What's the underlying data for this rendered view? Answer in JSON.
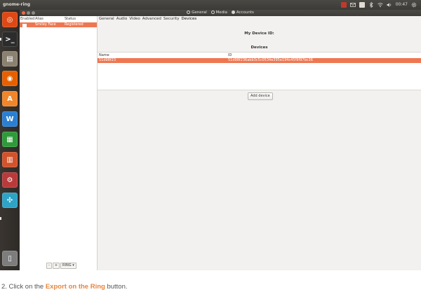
{
  "topbar": {
    "app_title": "gnome-ring",
    "clock": "00:47"
  },
  "launcher": {
    "items": [
      {
        "name": "ubuntu-dash-icon",
        "color": "#dd4814"
      },
      {
        "name": "terminal-icon",
        "color": "#2c2c2c"
      },
      {
        "name": "files-icon",
        "color": "#8b8170"
      },
      {
        "name": "firefox-icon",
        "color": "#e66000"
      },
      {
        "name": "software-center-icon",
        "color": "#f0852a"
      },
      {
        "name": "writer-icon",
        "color": "#2a7fd2"
      },
      {
        "name": "calc-icon",
        "color": "#2f9a3a"
      },
      {
        "name": "impress-icon",
        "color": "#d2532b"
      },
      {
        "name": "system-settings-icon",
        "color": "#b83a3a"
      },
      {
        "name": "ring-icon",
        "color": "#2ea3c6"
      },
      {
        "name": "trash-icon",
        "color": "#7d7d7d"
      }
    ]
  },
  "window": {
    "modes": [
      "General",
      "Media",
      "Accounts"
    ],
    "active_mode": "Accounts"
  },
  "accounts": {
    "columns": [
      "Enabled",
      "Alias",
      "Status"
    ],
    "rows": [
      {
        "enabled": true,
        "alias": "Smiley Face",
        "status": "Registered"
      }
    ],
    "controls": [
      "-",
      "+",
      "RING",
      "▾"
    ]
  },
  "settings": {
    "tabs": [
      "General",
      "Audio",
      "Video",
      "Advanced",
      "Security",
      "Devices"
    ],
    "active_tab": "Devices",
    "my_device_label": "My Device ID:",
    "devices_label": "Devices",
    "device_columns": [
      "Name",
      "ID"
    ],
    "devices": [
      {
        "name": "51d98f23",
        "id": "51d98f236abb3c5c0534e395e194c45f9f97bc36"
      }
    ],
    "add_device_label": "Add device"
  },
  "caption": {
    "prefix": "2. Click on the ",
    "highlight": "Export on the Ring",
    "suffix": " button."
  },
  "colors": {
    "accent": "#ee7752",
    "panel": "#3c3b37",
    "link": "#e8843b"
  }
}
